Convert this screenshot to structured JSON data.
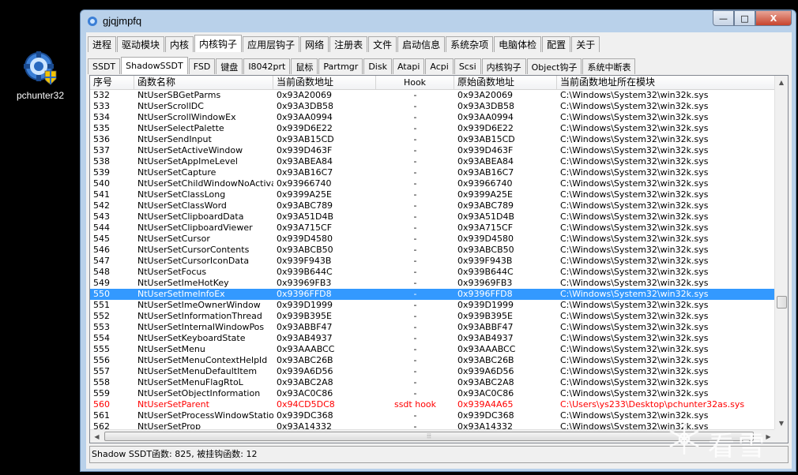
{
  "desktop": {
    "icon_label": "pchunter32"
  },
  "window": {
    "title": "gjqjmpfq",
    "controls": {
      "minimize": "—",
      "maximize": "□",
      "close": "X"
    }
  },
  "tabs": [
    "进程",
    "驱动模块",
    "内核",
    "内核钩子",
    "应用层钩子",
    "网络",
    "注册表",
    "文件",
    "启动信息",
    "系统杂项",
    "电脑体检",
    "配置",
    "关于"
  ],
  "active_tab": "内核钩子",
  "subtabs": [
    "SSDT",
    "ShadowSSDT",
    "FSD",
    "键盘",
    "I8042prt",
    "鼠标",
    "Partmgr",
    "Disk",
    "Atapi",
    "Acpi",
    "Scsi",
    "内核钩子",
    "Object钩子",
    "系统中断表"
  ],
  "active_subtab": "ShadowSSDT",
  "columns": [
    "序号",
    "函数名称",
    "当前函数地址",
    "Hook",
    "原始函数地址",
    "当前函数地址所在模块"
  ],
  "rows": [
    [
      "532",
      "NtUserSBGetParms",
      "0x93A20069",
      "-",
      "0x93A20069",
      "C:\\Windows\\System32\\win32k.sys"
    ],
    [
      "533",
      "NtUserScrollDC",
      "0x93A3DB58",
      "-",
      "0x93A3DB58",
      "C:\\Windows\\System32\\win32k.sys"
    ],
    [
      "534",
      "NtUserScrollWindowEx",
      "0x93AA0994",
      "-",
      "0x93AA0994",
      "C:\\Windows\\System32\\win32k.sys"
    ],
    [
      "535",
      "NtUserSelectPalette",
      "0x939D6E22",
      "-",
      "0x939D6E22",
      "C:\\Windows\\System32\\win32k.sys"
    ],
    [
      "536",
      "NtUserSendInput",
      "0x93AB15CD",
      "-",
      "0x93AB15CD",
      "C:\\Windows\\System32\\win32k.sys"
    ],
    [
      "537",
      "NtUserSetActiveWindow",
      "0x939D463F",
      "-",
      "0x939D463F",
      "C:\\Windows\\System32\\win32k.sys"
    ],
    [
      "538",
      "NtUserSetAppImeLevel",
      "0x93ABEA84",
      "-",
      "0x93ABEA84",
      "C:\\Windows\\System32\\win32k.sys"
    ],
    [
      "539",
      "NtUserSetCapture",
      "0x93AB16C7",
      "-",
      "0x93AB16C7",
      "C:\\Windows\\System32\\win32k.sys"
    ],
    [
      "540",
      "NtUserSetChildWindowNoActivate",
      "0x93966740",
      "-",
      "0x93966740",
      "C:\\Windows\\System32\\win32k.sys"
    ],
    [
      "541",
      "NtUserSetClassLong",
      "0x9399A25E",
      "-",
      "0x9399A25E",
      "C:\\Windows\\System32\\win32k.sys"
    ],
    [
      "542",
      "NtUserSetClassWord",
      "0x93ABC789",
      "-",
      "0x93ABC789",
      "C:\\Windows\\System32\\win32k.sys"
    ],
    [
      "543",
      "NtUserSetClipboardData",
      "0x93A51D4B",
      "-",
      "0x93A51D4B",
      "C:\\Windows\\System32\\win32k.sys"
    ],
    [
      "544",
      "NtUserSetClipboardViewer",
      "0x93A715CF",
      "-",
      "0x93A715CF",
      "C:\\Windows\\System32\\win32k.sys"
    ],
    [
      "545",
      "NtUserSetCursor",
      "0x939D4580",
      "-",
      "0x939D4580",
      "C:\\Windows\\System32\\win32k.sys"
    ],
    [
      "546",
      "NtUserSetCursorContents",
      "0x93ABCB50",
      "-",
      "0x93ABCB50",
      "C:\\Windows\\System32\\win32k.sys"
    ],
    [
      "547",
      "NtUserSetCursorIconData",
      "0x939F943B",
      "-",
      "0x939F943B",
      "C:\\Windows\\System32\\win32k.sys"
    ],
    [
      "548",
      "NtUserSetFocus",
      "0x939B644C",
      "-",
      "0x939B644C",
      "C:\\Windows\\System32\\win32k.sys"
    ],
    [
      "549",
      "NtUserSetImeHotKey",
      "0x93969FB3",
      "-",
      "0x93969FB3",
      "C:\\Windows\\System32\\win32k.sys"
    ],
    [
      "550",
      "NtUserSetImeInfoEx",
      "0x9396FFD8",
      "-",
      "0x9396FFD8",
      "C:\\Windows\\System32\\win32k.sys"
    ],
    [
      "551",
      "NtUserSetImeOwnerWindow",
      "0x939D1999",
      "-",
      "0x939D1999",
      "C:\\Windows\\System32\\win32k.sys"
    ],
    [
      "552",
      "NtUserSetInformationThread",
      "0x939B395E",
      "-",
      "0x939B395E",
      "C:\\Windows\\System32\\win32k.sys"
    ],
    [
      "553",
      "NtUserSetInternalWindowPos",
      "0x93ABBF47",
      "-",
      "0x93ABBF47",
      "C:\\Windows\\System32\\win32k.sys"
    ],
    [
      "554",
      "NtUserSetKeyboardState",
      "0x93AB4937",
      "-",
      "0x93AB4937",
      "C:\\Windows\\System32\\win32k.sys"
    ],
    [
      "555",
      "NtUserSetMenu",
      "0x93AAABCC",
      "-",
      "0x93AAABCC",
      "C:\\Windows\\System32\\win32k.sys"
    ],
    [
      "556",
      "NtUserSetMenuContextHelpId",
      "0x93ABC26B",
      "-",
      "0x93ABC26B",
      "C:\\Windows\\System32\\win32k.sys"
    ],
    [
      "557",
      "NtUserSetMenuDefaultItem",
      "0x939A6D56",
      "-",
      "0x939A6D56",
      "C:\\Windows\\System32\\win32k.sys"
    ],
    [
      "558",
      "NtUserSetMenuFlagRtoL",
      "0x93ABC2A8",
      "-",
      "0x93ABC2A8",
      "C:\\Windows\\System32\\win32k.sys"
    ],
    [
      "559",
      "NtUserSetObjectInformation",
      "0x93AC0C86",
      "-",
      "0x93AC0C86",
      "C:\\Windows\\System32\\win32k.sys"
    ],
    [
      "560",
      "NtUserSetParent",
      "0x94CD5DC8",
      "ssdt hook",
      "0x939A4A65",
      "C:\\Users\\ys233\\Desktop\\pchunter32as.sys"
    ],
    [
      "561",
      "NtUserSetProcessWindowStation",
      "0x939DC368",
      "-",
      "0x939DC368",
      "C:\\Windows\\System32\\win32k.sys"
    ],
    [
      "562",
      "NtUserSetProp",
      "0x93A14332",
      "-",
      "0x93A14332",
      "C:\\Windows\\System32\\win32k.sys"
    ]
  ],
  "selected_row": "550",
  "hooked_row": "560",
  "status_text": "Shadow SSDT函数: 825, 被挂钩函数: 12",
  "watermark": "看雪",
  "colors": {
    "selection": "#3399ff",
    "hooked": "#ff0000",
    "title_bg": "#b9d1ea"
  },
  "icons": [
    "pchunter-app-icon",
    "window-app-icon",
    "minimize-icon",
    "maximize-icon",
    "close-icon",
    "snowflake-watermark-icon"
  ]
}
